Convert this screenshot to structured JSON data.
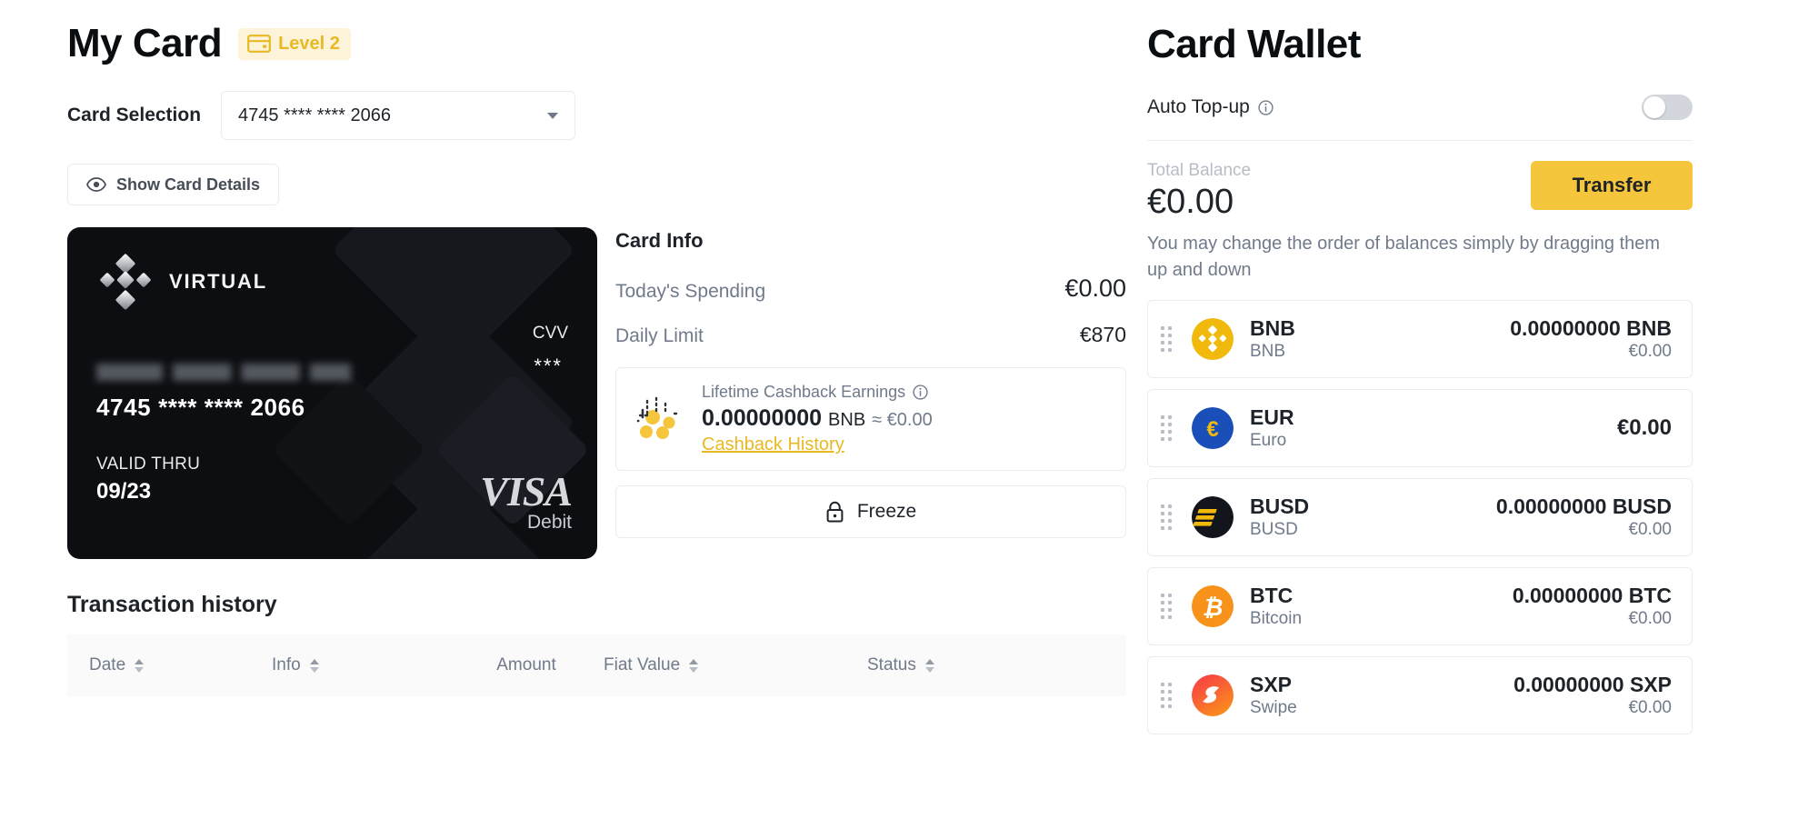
{
  "header": {
    "title": "My Card",
    "level_badge": {
      "label": "Level 2",
      "icon": "card-icon",
      "bg": "#FCF3D9",
      "fg": "#E8B923"
    }
  },
  "card_selection": {
    "label": "Card Selection",
    "selected_value": "4745 **** **** 2066",
    "show_details_label": "Show Card Details"
  },
  "credit_card": {
    "brand_label": "VIRTUAL",
    "holder_name_masked": "",
    "number": "4745 **** **** 2066",
    "cvv_label": "CVV",
    "cvv_value": "***",
    "valid_thru_label": "VALID THRU",
    "valid_thru_value": "09/23",
    "network": "VISA",
    "network_type": "Debit",
    "background": "#0C0E11"
  },
  "card_info": {
    "heading": "Card Info",
    "rows": [
      {
        "label": "Today's Spending",
        "value": "€0.00"
      },
      {
        "label": "Daily Limit",
        "value": "€870"
      }
    ],
    "cashback": {
      "title": "Lifetime Cashback Earnings",
      "amount": "0.00000000",
      "unit": "BNB",
      "approx": "≈ €0.00",
      "link_label": "Cashback History",
      "link_color": "#E8B923"
    },
    "freeze_label": "Freeze"
  },
  "transactions": {
    "heading": "Transaction history",
    "columns": [
      {
        "label": "Date",
        "sortable": true
      },
      {
        "label": "Info",
        "sortable": true
      },
      {
        "label": "Amount",
        "sortable": false
      },
      {
        "label": "Fiat Value",
        "sortable": true
      },
      {
        "label": "Status",
        "sortable": true
      }
    ],
    "rows": []
  },
  "wallet": {
    "title": "Card Wallet",
    "auto_topup": {
      "label": "Auto Top-up",
      "enabled": false
    },
    "total_balance_label": "Total Balance",
    "total_balance_value": "€0.00",
    "transfer_label": "Transfer",
    "hint": "You may change the order of balances simply by dragging them up and down",
    "assets": [
      {
        "symbol": "BNB",
        "name": "BNB",
        "amount": "0.00000000 BNB",
        "fiat": "€0.00",
        "icon": "bnb-icon",
        "color": "#F0B90B"
      },
      {
        "symbol": "EUR",
        "name": "Euro",
        "amount": "€0.00",
        "fiat": "",
        "icon": "eur-icon",
        "color": "#1A4FBA"
      },
      {
        "symbol": "BUSD",
        "name": "BUSD",
        "amount": "0.00000000 BUSD",
        "fiat": "€0.00",
        "icon": "busd-icon",
        "color": "#12161C"
      },
      {
        "symbol": "BTC",
        "name": "Bitcoin",
        "amount": "0.00000000 BTC",
        "fiat": "€0.00",
        "icon": "btc-icon",
        "color": "#F7931A"
      },
      {
        "symbol": "SXP",
        "name": "Swipe",
        "amount": "0.00000000 SXP",
        "fiat": "€0.00",
        "icon": "sxp-icon",
        "color": "#F9473B"
      }
    ]
  }
}
